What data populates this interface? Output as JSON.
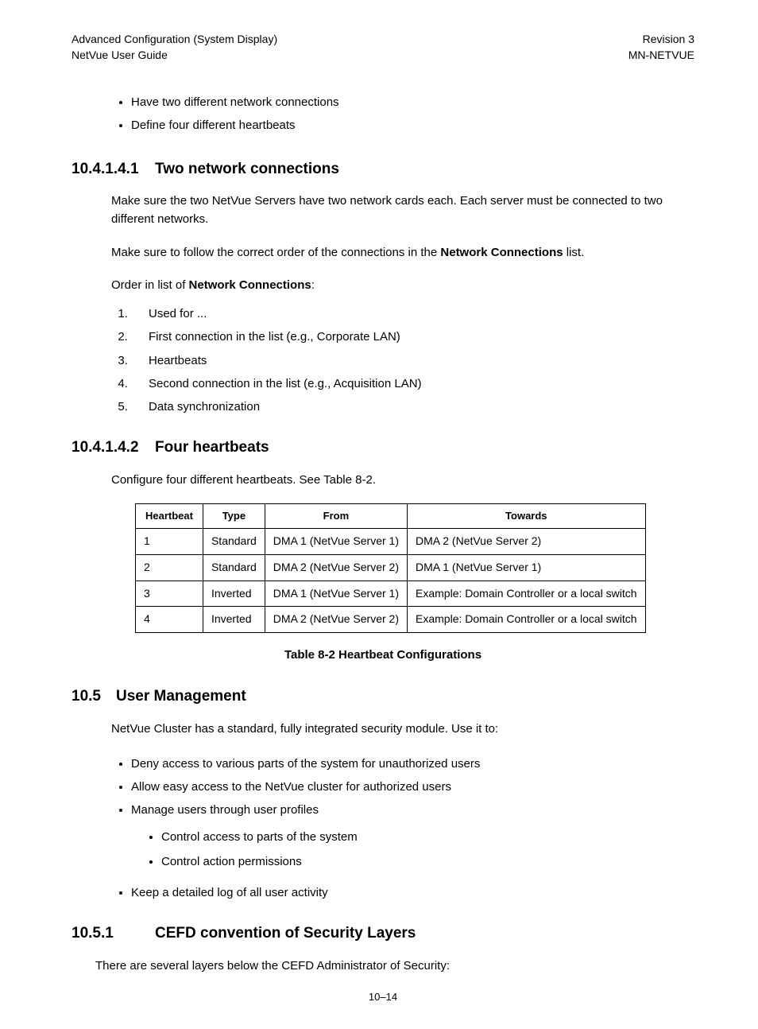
{
  "header": {
    "left_line1": "Advanced Configuration (System Display)",
    "left_line2": "NetVue User Guide",
    "right_line1": "Revision 3",
    "right_line2": "MN-NETVUE"
  },
  "intro_bullets": [
    "Have two different network connections",
    "Define four different heartbeats"
  ],
  "sec1": {
    "num": "10.4.1.4.1",
    "title": "Two network connections",
    "p1": "Make sure the two NetVue Servers have two network cards each. Each server must be connected to two different networks.",
    "p2_pre": "Make sure to follow the correct order of the connections in the ",
    "p2_bold": "Network Connections",
    "p2_post": " list.",
    "p3_pre": "Order in list of ",
    "p3_bold": "Network Connections",
    "p3_post": ":",
    "ordered": [
      "Used for ...",
      "First connection in the list (e.g., Corporate LAN)",
      "Heartbeats",
      "Second connection in the list (e.g., Acquisition LAN)",
      "Data synchronization"
    ]
  },
  "sec2": {
    "num": "10.4.1.4.2",
    "title": "Four heartbeats",
    "p1": "Configure four different heartbeats. See Table 8-2.",
    "table": {
      "headers": [
        "Heartbeat",
        "Type",
        "From",
        "Towards"
      ],
      "rows": [
        [
          "1",
          "Standard",
          "DMA 1 (NetVue Server 1)",
          "DMA 2 (NetVue Server 2)"
        ],
        [
          "2",
          "Standard",
          "DMA 2 (NetVue Server 2)",
          "DMA 1 (NetVue Server 1)"
        ],
        [
          "3",
          "Inverted",
          "DMA 1 (NetVue Server 1)",
          "Example: Domain Controller or a local switch"
        ],
        [
          "4",
          "Inverted",
          "DMA 2 (NetVue Server 2)",
          "Example: Domain Controller or a local switch"
        ]
      ]
    },
    "caption": "Table 8-2 Heartbeat Configurations"
  },
  "sec3": {
    "num": "10.5",
    "title": "User Management",
    "p1": "NetVue Cluster has a standard, fully integrated security module. Use it to:",
    "bullets": [
      "Deny access to various parts of the system for unauthorized users",
      "Allow easy access to the NetVue cluster for authorized users",
      "Manage users through user profiles",
      "Keep a detailed log of all user activity"
    ],
    "sub_bullets": [
      "Control access to parts of the system",
      "Control action permissions"
    ]
  },
  "sec4": {
    "num": "10.5.1",
    "title": "CEFD convention of Security Layers",
    "p1": "There are several layers below the CEFD Administrator of Security:"
  },
  "page_number": "10–14"
}
